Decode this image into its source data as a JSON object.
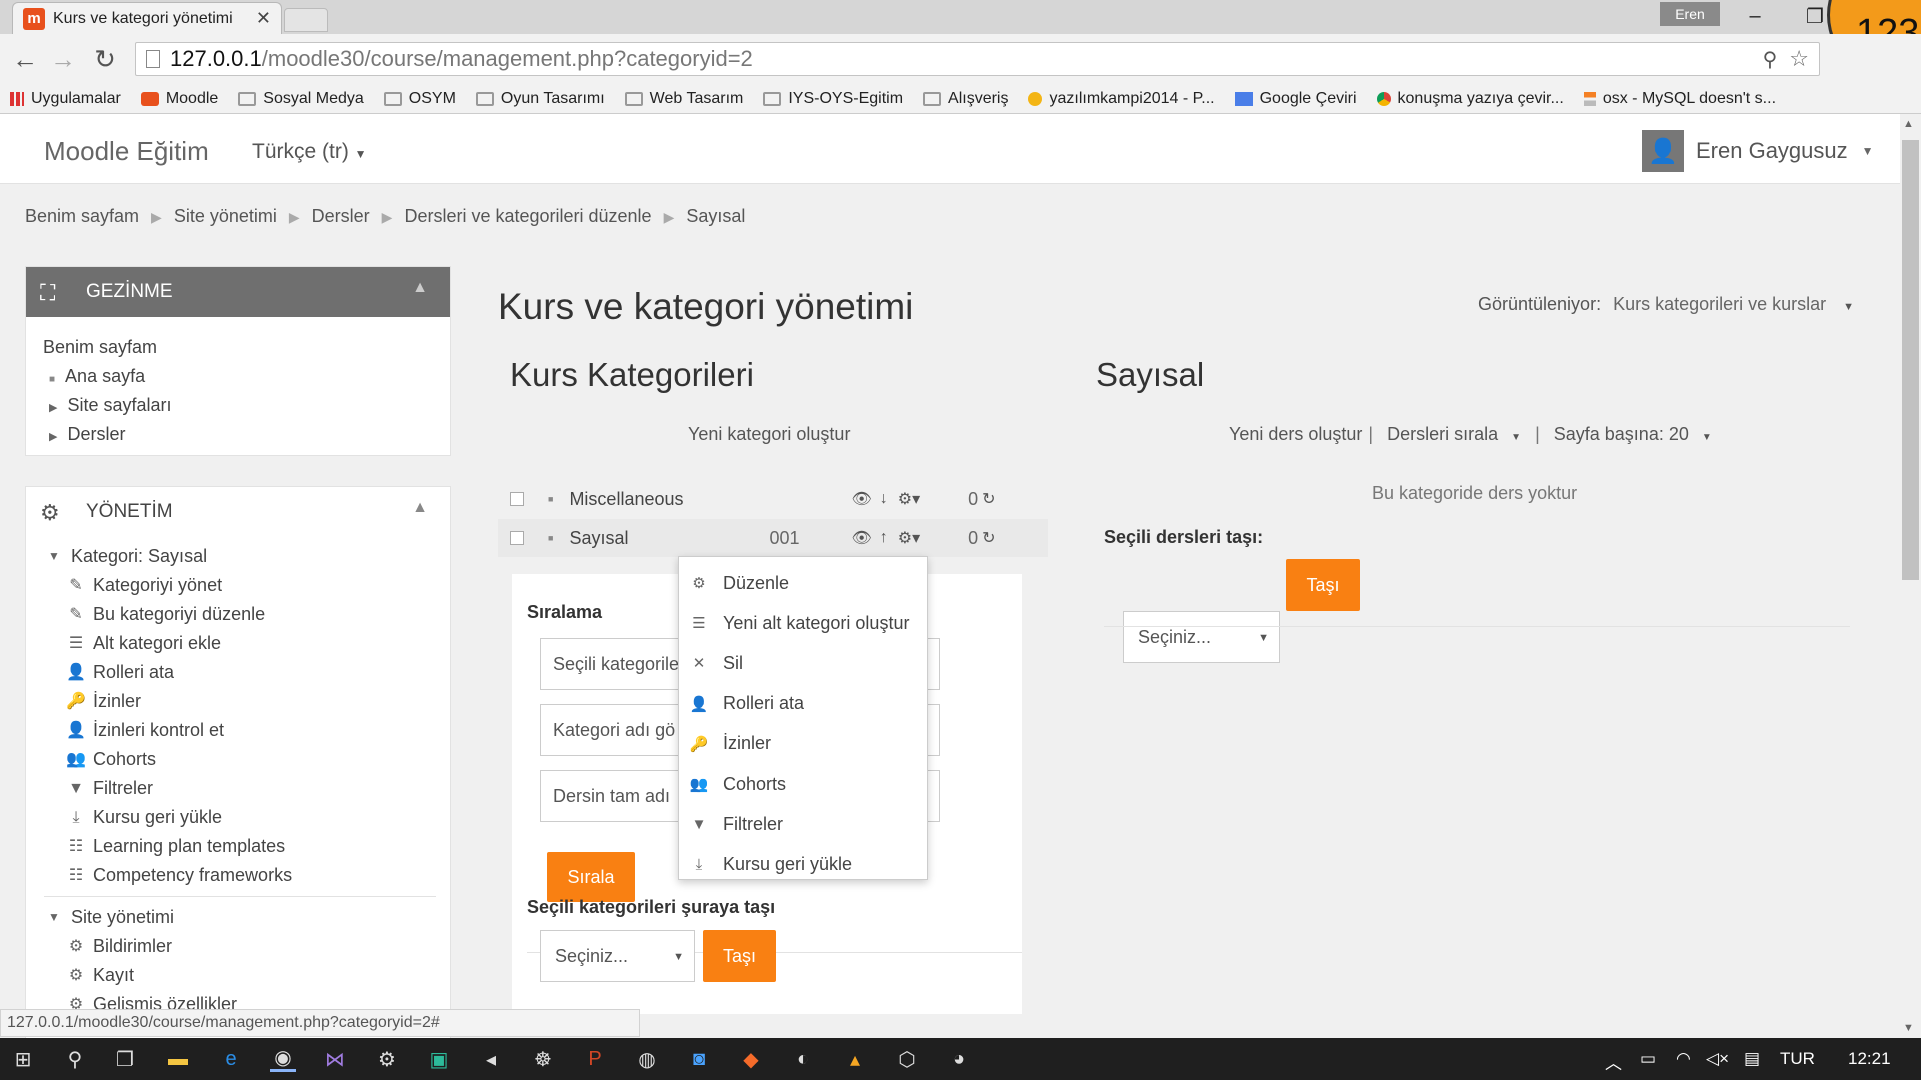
{
  "browser": {
    "tab_title": "Kurs ve kategori yönetimi",
    "tab_icon": "m",
    "profile": "Eren",
    "badge": "123",
    "url_host": "127.0.0.1",
    "url_path": "/moodle30/course/management.php?categoryid=2",
    "bookmarks": [
      {
        "label": "Uygulamalar",
        "icon": "apps-icon"
      },
      {
        "label": "Moodle",
        "icon": "moodle-icon"
      },
      {
        "label": "Sosyal Medya",
        "icon": "folder-icon"
      },
      {
        "label": "OSYM",
        "icon": "folder-icon"
      },
      {
        "label": "Oyun Tasarımı",
        "icon": "folder-icon"
      },
      {
        "label": "Web Tasarım",
        "icon": "folder-icon"
      },
      {
        "label": "IYS-OYS-Egitim",
        "icon": "folder-icon"
      },
      {
        "label": "Alışveriş",
        "icon": "folder-icon"
      },
      {
        "label": "yazılımkampi2014 - P...",
        "icon": "yazilim-icon"
      },
      {
        "label": "Google Çeviri",
        "icon": "translate-icon"
      },
      {
        "label": "konuşma yazıya çevir...",
        "icon": "chrome-icon"
      },
      {
        "label": "osx - MySQL doesn't s...",
        "icon": "stack-icon"
      }
    ],
    "status_url": "127.0.0.1/moodle30/course/management.php?categoryid=2#"
  },
  "navbar": {
    "brand": "Moodle Eğitim",
    "language": "Türkçe (tr)",
    "user": "Eren Gaygusuz"
  },
  "breadcrumb": [
    "Benim sayfam",
    "Site yönetimi",
    "Dersler",
    "Dersleri ve kategorileri düzenle",
    "Sayısal"
  ],
  "nav_block": {
    "title": "GEZİNME",
    "root": "Benim sayfam",
    "items": [
      "Ana sayfa",
      "Site sayfaları",
      "Dersler"
    ]
  },
  "admin_block": {
    "title": "YÖNETİM",
    "category_label": "Kategori: Sayısal",
    "items": [
      {
        "label": "Kategoriyi yönet",
        "icon": "pencil-icon"
      },
      {
        "label": "Bu kategoriyi düzenle",
        "icon": "pencil-icon"
      },
      {
        "label": "Alt kategori ekle",
        "icon": "subcategory-icon"
      },
      {
        "label": "Rolleri ata",
        "icon": "user-icon"
      },
      {
        "label": "İzinler",
        "icon": "key-icon"
      },
      {
        "label": "İzinleri kontrol et",
        "icon": "user-check-icon"
      },
      {
        "label": "Cohorts",
        "icon": "users-icon"
      },
      {
        "label": "Filtreler",
        "icon": "filter-icon"
      },
      {
        "label": "Kursu geri yükle",
        "icon": "restore-icon"
      },
      {
        "label": "Learning plan templates",
        "icon": "template-icon"
      },
      {
        "label": "Competency frameworks",
        "icon": "template-icon"
      }
    ],
    "site_admin_label": "Site yönetimi",
    "site_items": [
      "Bildirimler",
      "Kayıt",
      "Gelişmiş özellikler"
    ]
  },
  "main": {
    "title": "Kurs ve kategori yönetimi",
    "viewing_label": "Görüntüleniyor:",
    "viewing_value": "Kurs kategorileri ve kurslar",
    "categories": {
      "heading": "Kurs Kategorileri",
      "new_link": "Yeni kategori oluştur",
      "rows": [
        {
          "name": "Miscellaneous",
          "idnumber": "",
          "count": "0"
        },
        {
          "name": "Sayısal",
          "idnumber": "001",
          "count": "0"
        }
      ],
      "sort_label": "Sıralama",
      "sort_options": [
        "Seçili kategorileri",
        "Kategori adı gö",
        "Dersin tam adı"
      ],
      "sort_button": "Sırala",
      "move_label": "Seçili kategorileri şuraya taşı",
      "move_select": "Seçiniz...",
      "move_button": "Taşı"
    },
    "courses": {
      "heading": "Sayısal",
      "new_course": "Yeni ders oluştur",
      "sort_courses": "Dersleri sırala",
      "per_page": "Sayfa başına: 20",
      "empty": "Bu kategoride ders yoktur",
      "move_label": "Seçili dersleri taşı:",
      "move_select": "Seçiniz...",
      "move_button": "Taşı"
    },
    "context_menu": [
      {
        "label": "Düzenle",
        "icon": "gear-icon"
      },
      {
        "label": "Yeni alt kategori oluştur",
        "icon": "subcategory-icon"
      },
      {
        "label": "Sil",
        "icon": "close-icon"
      },
      {
        "label": "Rolleri ata",
        "icon": "user-icon"
      },
      {
        "label": "İzinler",
        "icon": "key-icon"
      },
      {
        "label": "Cohorts",
        "icon": "users-icon"
      },
      {
        "label": "Filtreler",
        "icon": "filter-icon"
      },
      {
        "label": "Kursu geri yükle",
        "icon": "restore-icon"
      }
    ]
  },
  "taskbar": {
    "language": "TUR",
    "time": "12:21"
  },
  "colors": {
    "accent": "#f98012",
    "block_header": "#6f6f6f"
  }
}
